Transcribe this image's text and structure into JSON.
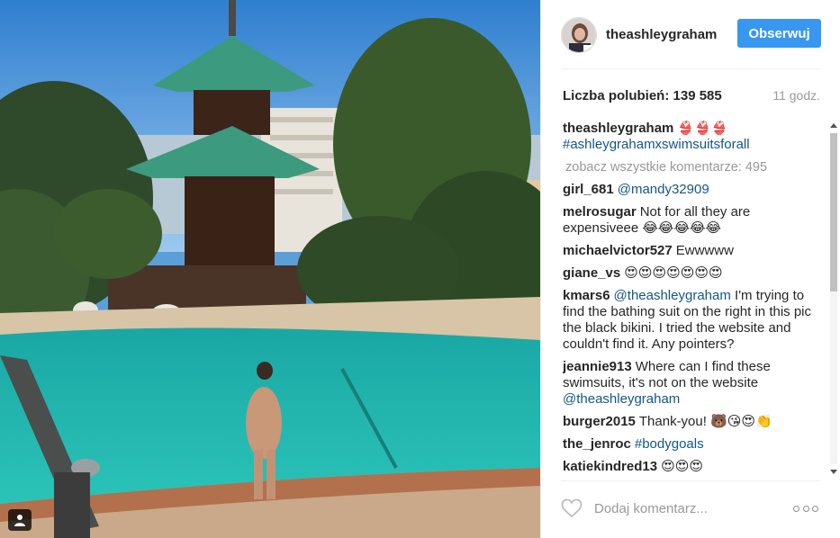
{
  "post": {
    "username": "theashleygraham",
    "follow_label": "Obserwuj",
    "likes_label": "Liczba polubień:",
    "likes_count": "139 585",
    "time_ago": "11 godz."
  },
  "caption": {
    "username": "theashleygraham",
    "emoji": "👙👙👙",
    "hashtag": "#ashleygrahamxswimsuitsforall"
  },
  "view_all": "zobacz wszystkie komentarze: 495",
  "comments": [
    {
      "user": "girl_681",
      "mention": "@mandy32909",
      "text": ""
    },
    {
      "user": "melrosugar",
      "mention": "",
      "text": "Not for all they are expensiveee 😂😂😂😂😂"
    },
    {
      "user": "michaelvictor527",
      "mention": "",
      "text": "Ewwwww"
    },
    {
      "user": "giane_vs",
      "mention": "",
      "text": "😍😍😍😍😍😍😍"
    },
    {
      "user": "kmars6",
      "mention": "@theashleygraham",
      "text": " I'm trying to find the bathing suit on the right in this pic the black bikini. I tried the website and couldn't find it. Any pointers?"
    },
    {
      "user": "jeannie913",
      "mention": "",
      "text": "Where can I find these swimsuits, it's not on the website ",
      "mention_after": "@theashleygraham"
    },
    {
      "user": "burger2015",
      "mention": "",
      "text": "Thank-you! 🐻😘😍👏"
    },
    {
      "user": "the_jenroc",
      "mention": "",
      "text": "",
      "hashtag": "#bodygoals"
    },
    {
      "user": "katiekindred13",
      "mention": "",
      "text": "😍😍😍"
    }
  ],
  "comment_box": {
    "placeholder": "Dodaj komentarz..."
  },
  "icons": {
    "heart": "heart-outline-icon",
    "more": "more-options-icon",
    "tag": "user-tag-icon"
  },
  "colors": {
    "follow_button": "#3897f0",
    "link": "#125688",
    "muted": "#999999"
  }
}
